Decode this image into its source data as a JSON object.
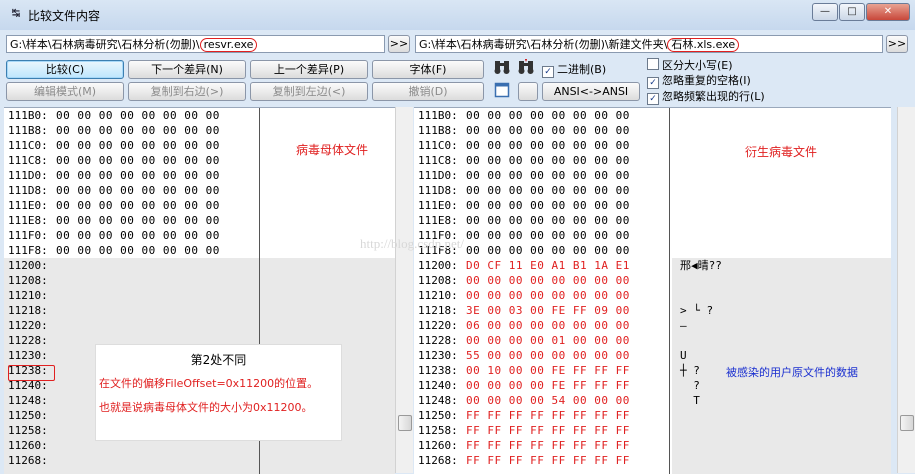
{
  "window": {
    "icon_text": "↹",
    "title": "比较文件内容",
    "min": "—",
    "max": "□",
    "close": "✕"
  },
  "paths": {
    "left_prefix": "G:\\样本\\石林病毒研究\\石林分析(勿删)\\",
    "left_file": "resvr.exe",
    "right_prefix": "G:\\样本\\石林病毒研究\\石林分析(勿删)\\新建文件夹\\",
    "right_file": "石林.xls.exe",
    "browse": ">>"
  },
  "toolbar": {
    "compare": "比较(C)",
    "next_diff": "下一个差异(N)",
    "prev_diff": "上一个差异(P)",
    "font": "字体(F)",
    "edit_mode": "编辑模式(M)",
    "copy_right": "复制到右边(>)",
    "copy_left": "复制到左边(<)",
    "undo": "撤销(D)",
    "ansi": "ANSI<->ANSI",
    "binary": "二进制(B)",
    "case": "区分大小写(E)",
    "ignore_spaces": "忽略重复的空格(I)",
    "ignore_lines": "忽略频繁出现的行(L)",
    "check": "✓",
    "binoculars_icon": "binoculars-icon",
    "find_next_icon": "find-next-icon",
    "square_icon": "window-icon"
  },
  "left_pane": {
    "label": "病毒母体文件",
    "rows": [
      {
        "addr": "111B0:",
        "bytes": "00 00 00 00 00 00 00 00"
      },
      {
        "addr": "111B8:",
        "bytes": "00 00 00 00 00 00 00 00"
      },
      {
        "addr": "111C0:",
        "bytes": "00 00 00 00 00 00 00 00"
      },
      {
        "addr": "111C8:",
        "bytes": "00 00 00 00 00 00 00 00"
      },
      {
        "addr": "111D0:",
        "bytes": "00 00 00 00 00 00 00 00"
      },
      {
        "addr": "111D8:",
        "bytes": "00 00 00 00 00 00 00 00"
      },
      {
        "addr": "111E0:",
        "bytes": "00 00 00 00 00 00 00 00"
      },
      {
        "addr": "111E8:",
        "bytes": "00 00 00 00 00 00 00 00"
      },
      {
        "addr": "111F0:",
        "bytes": "00 00 00 00 00 00 00 00"
      },
      {
        "addr": "111F8:",
        "bytes": "00 00 00 00 00 00 00 00"
      },
      {
        "addr": "11200:",
        "bytes": ""
      },
      {
        "addr": "11208:",
        "bytes": ""
      },
      {
        "addr": "11210:",
        "bytes": ""
      },
      {
        "addr": "11218:",
        "bytes": ""
      },
      {
        "addr": "11220:",
        "bytes": ""
      },
      {
        "addr": "11228:",
        "bytes": ""
      },
      {
        "addr": "11230:",
        "bytes": ""
      },
      {
        "addr": "11238:",
        "bytes": ""
      },
      {
        "addr": "11240:",
        "bytes": ""
      },
      {
        "addr": "11248:",
        "bytes": ""
      },
      {
        "addr": "11250:",
        "bytes": ""
      },
      {
        "addr": "11258:",
        "bytes": ""
      },
      {
        "addr": "11260:",
        "bytes": ""
      },
      {
        "addr": "11268:",
        "bytes": ""
      }
    ]
  },
  "right_pane": {
    "label": "衍生病毒文件",
    "data_label": "被感染的用户原文件的数据",
    "rows": [
      {
        "addr": "111B0:",
        "bytes": "00 00 00 00 00 00 00 00",
        "text": ""
      },
      {
        "addr": "111B8:",
        "bytes": "00 00 00 00 00 00 00 00",
        "text": ""
      },
      {
        "addr": "111C0:",
        "bytes": "00 00 00 00 00 00 00 00",
        "text": ""
      },
      {
        "addr": "111C8:",
        "bytes": "00 00 00 00 00 00 00 00",
        "text": ""
      },
      {
        "addr": "111D0:",
        "bytes": "00 00 00 00 00 00 00 00",
        "text": ""
      },
      {
        "addr": "111D8:",
        "bytes": "00 00 00 00 00 00 00 00",
        "text": ""
      },
      {
        "addr": "111E0:",
        "bytes": "00 00 00 00 00 00 00 00",
        "text": ""
      },
      {
        "addr": "111E8:",
        "bytes": "00 00 00 00 00 00 00 00",
        "text": ""
      },
      {
        "addr": "111F0:",
        "bytes": "00 00 00 00 00 00 00 00",
        "text": ""
      },
      {
        "addr": "111F8:",
        "bytes": "00 00 00 00 00 00 00 00",
        "text": ""
      },
      {
        "addr": "11200:",
        "bytes": "D0 CF 11 E0 A1 B1 1A E1",
        "text": "邢◀晴??"
      },
      {
        "addr": "11208:",
        "bytes": "00 00 00 00 00 00 00 00",
        "text": ""
      },
      {
        "addr": "11210:",
        "bytes": "00 00 00 00 00 00 00 00",
        "text": ""
      },
      {
        "addr": "11218:",
        "bytes": "3E 00 03 00 FE FF 09 00",
        "text": "> └ ?"
      },
      {
        "addr": "11220:",
        "bytes": "06 00 00 00 00 00 00 00",
        "text": "–"
      },
      {
        "addr": "11228:",
        "bytes": "00 00 00 00 01 00 00 00",
        "text": ""
      },
      {
        "addr": "11230:",
        "bytes": "55 00 00 00 00 00 00 00",
        "text": "U"
      },
      {
        "addr": "11238:",
        "bytes": "00 10 00 00 FE FF FF FF",
        "text": "┼ ?"
      },
      {
        "addr": "11240:",
        "bytes": "00 00 00 00 FE FF FF FF",
        "text": "  ?"
      },
      {
        "addr": "11248:",
        "bytes": "00 00 00 00 54 00 00 00",
        "text": "  T"
      },
      {
        "addr": "11250:",
        "bytes": "FF FF FF FF FF FF FF FF",
        "text": ""
      },
      {
        "addr": "11258:",
        "bytes": "FF FF FF FF FF FF FF FF",
        "text": ""
      },
      {
        "addr": "11260:",
        "bytes": "FF FF FF FF FF FF FF FF",
        "text": ""
      },
      {
        "addr": "11268:",
        "bytes": "FF FF FF FF FF FF FF FF",
        "text": ""
      }
    ]
  },
  "annotation": {
    "heading": "第2处不同",
    "line1": "在文件的偏移FileOffset=0x11200的位置。",
    "line2": "也就是说病毒母体文件的大小为0x11200。"
  },
  "watermark": "http://blog.csdn.net/",
  "colors": {
    "diff": "#e02020",
    "note_blue": "#1a2fd0"
  }
}
